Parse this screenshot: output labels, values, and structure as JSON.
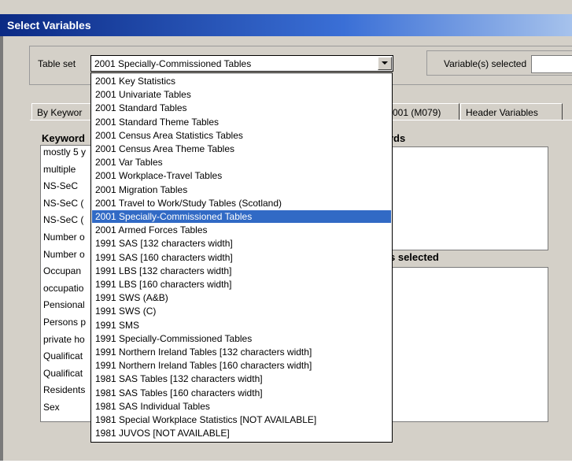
{
  "window": {
    "title": "Select Variables"
  },
  "table_set": {
    "label": "Table set",
    "selected_value": "2001 Specially-Commissioned Tables",
    "options": [
      "2001 Key Statistics",
      "2001 Univariate Tables",
      "2001 Standard Tables",
      "2001 Standard Theme Tables",
      "2001 Census Area Statistics Tables",
      "2001 Census Area Theme Tables",
      "2001 Var Tables",
      "2001 Workplace-Travel Tables",
      "2001 Migration Tables",
      "2001 Travel to Work/Study Tables (Scotland)",
      "2001 Specially-Commissioned Tables",
      "2001 Armed Forces Tables",
      "1991 SAS [132 characters width]",
      "1991 SAS [160 characters width]",
      "1991 LBS [132 characters width]",
      "1991 LBS [160 characters width]",
      "1991 SWS (A&B)",
      "1991 SWS (C)",
      "1991 SMS",
      "1991 Specially-Commissioned Tables",
      "1991 Northern Ireland Tables [132 characters width]",
      "1991 Northern Ireland Tables [160 characters width]",
      "1981 SAS Tables [132 characters width]",
      "1981 SAS Tables [160 characters width]",
      "1981 SAS Individual Tables",
      "1981 Special Workplace Statistics [NOT AVAILABLE]",
      "1981 JUVOS [NOT AVAILABLE]"
    ]
  },
  "variables_selected": {
    "label": "Variable(s) selected"
  },
  "tabs": [
    {
      "label": "By Keywor"
    },
    {
      "label": "001 (M079)"
    },
    {
      "label": "Header Variables"
    }
  ],
  "keywords": {
    "heading": "Keyword",
    "items": [
      "mostly 5 y",
      "multiple",
      "NS-SeC",
      "NS-SeC (",
      "NS-SeC (",
      "Number o",
      "Number o",
      "Occupan",
      "occupatio",
      "Pensional",
      "Persons p",
      "private ho",
      "Qualificat",
      "Qualificat",
      "Residents",
      "Sex"
    ]
  },
  "words_heading": "rds",
  "selected_heading": "s selected"
}
